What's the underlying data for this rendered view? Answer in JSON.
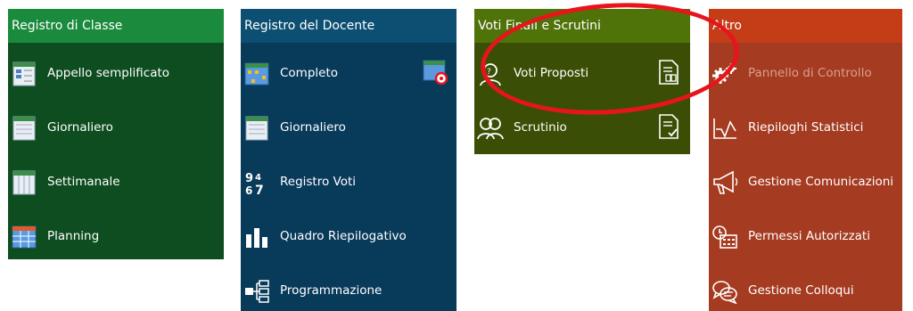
{
  "panels": {
    "registro_classe": {
      "title": "Registro di Classe",
      "items": [
        {
          "label": "Appello semplificato",
          "icon": "attendance-sheet-icon"
        },
        {
          "label": "Giornaliero",
          "icon": "daily-sheet-icon"
        },
        {
          "label": "Settimanale",
          "icon": "weekly-sheet-icon"
        },
        {
          "label": "Planning",
          "icon": "planning-grid-icon"
        }
      ]
    },
    "registro_docente": {
      "title": "Registro del Docente",
      "items": [
        {
          "label": "Completo",
          "icon": "grid-calendar-icon",
          "right_icon": "grid-target-icon"
        },
        {
          "label": "Giornaliero",
          "icon": "daily-sheet-icon"
        },
        {
          "label": "Registro Voti",
          "icon": "grades-numbers-icon"
        },
        {
          "label": "Quadro Riepilogativo",
          "icon": "bar-chart-icon"
        },
        {
          "label": "Programmazione",
          "icon": "hierarchy-icon"
        }
      ]
    },
    "voti_finali": {
      "title": "Voti Finali e Scrutini",
      "items": [
        {
          "label": "Voti Proposti",
          "icon": "user-question-icon",
          "right_icon": "document-people-icon"
        },
        {
          "label": "Scrutinio",
          "icon": "users-icon",
          "right_icon": "document-check-icon"
        }
      ]
    },
    "altro": {
      "title": "Altro",
      "items": [
        {
          "label": "Pannello di Controllo",
          "icon": "gears-icon",
          "disabled": true
        },
        {
          "label": "Riepiloghi Statistici",
          "icon": "line-chart-icon"
        },
        {
          "label": "Gestione Comunicazioni",
          "icon": "megaphone-icon"
        },
        {
          "label": "Permessi Autorizzati",
          "icon": "clock-calendar-icon"
        },
        {
          "label": "Gestione Colloqui",
          "icon": "chat-bubbles-icon"
        }
      ]
    }
  },
  "colors": {
    "green_header": "#1a8a3c",
    "green_body": "#0e4d20",
    "blue_header": "#0c4f72",
    "blue_body": "#083a5a",
    "olive_header": "#4f7209",
    "olive_body": "#3a4f05",
    "red_header": "#c43d17",
    "red_body": "#a53b21",
    "highlight": "#e8141c"
  }
}
